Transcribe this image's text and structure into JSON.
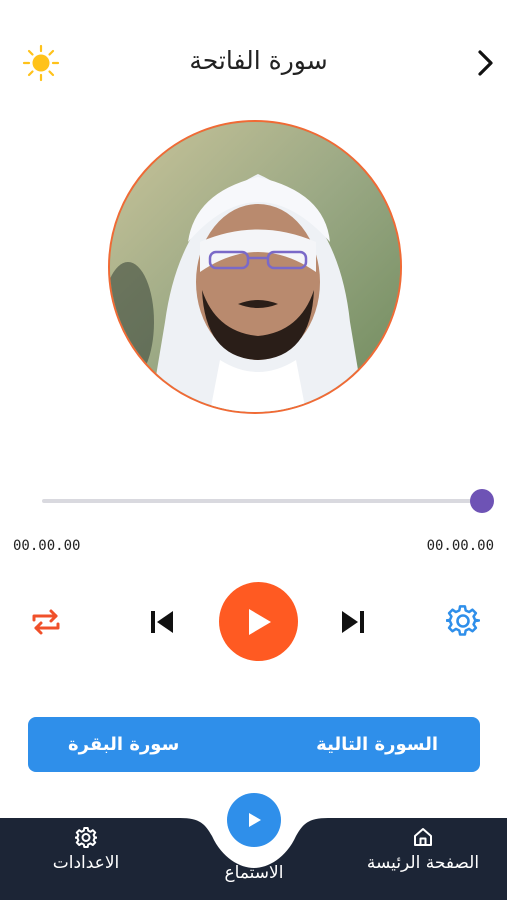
{
  "header": {
    "title": "سورة الفاتحة",
    "theme_icon": "sun-icon",
    "back_icon": "chevron-right-icon"
  },
  "player": {
    "reciter_photo": "reciter-portrait",
    "progress": 1.0,
    "elapsed": "00.00.00",
    "duration": "00.00.00",
    "controls": {
      "repeat_icon": "repeat-icon",
      "prev_icon": "skip-previous-icon",
      "play_icon": "play-icon",
      "next_icon": "skip-next-icon",
      "settings_icon": "gear-icon"
    }
  },
  "next_surah": {
    "label": "السورة التالية",
    "name": "سورة البقرة"
  },
  "tabbar": {
    "home": "الصفحة الرئيسة",
    "listen": "الاستماع",
    "settings": "الاعدادات"
  },
  "colors": {
    "accent_orange": "#ff5a22",
    "accent_blue": "#2f8fea",
    "slider_thumb": "#6e53b5",
    "tabbar_bg": "#1c2536",
    "sun": "#ffc21a"
  }
}
